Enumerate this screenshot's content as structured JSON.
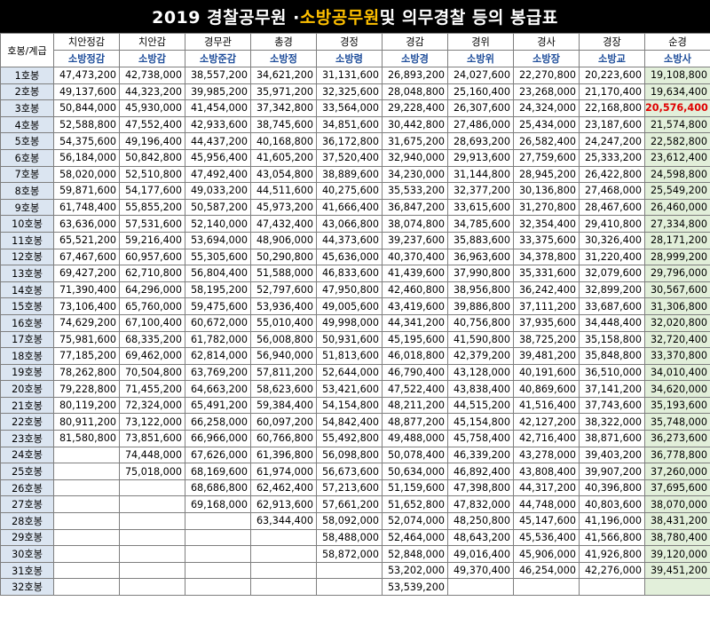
{
  "title": {
    "part1": "2019 경찰공무원 · ",
    "highlight": "소방공무원",
    "part2": " 및 의무경찰 등의 봉급표"
  },
  "header": {
    "rank_label": "호봉/계급",
    "ranks": [
      {
        "police": "치안정감",
        "fire": "소방정감"
      },
      {
        "police": "치안감",
        "fire": "소방감"
      },
      {
        "police": "경무관",
        "fire": "소방준감"
      },
      {
        "police": "총경",
        "fire": "소방정"
      },
      {
        "police": "경정",
        "fire": "소방령"
      },
      {
        "police": "경감",
        "fire": "소방경"
      },
      {
        "police": "경위",
        "fire": "소방위"
      },
      {
        "police": "경사",
        "fire": "소방장"
      },
      {
        "police": "경장",
        "fire": "소방교"
      },
      {
        "police": "순경",
        "fire": "소방사"
      }
    ]
  },
  "highlight_color": "#e00000",
  "highlight_cell": {
    "row": 3,
    "col": 9
  },
  "rows": [
    {
      "step": "1호봉",
      "v": [
        "47,473,200",
        "42,738,000",
        "38,557,200",
        "34,621,200",
        "31,131,600",
        "26,893,200",
        "24,027,600",
        "22,270,800",
        "20,223,600",
        "19,108,800"
      ]
    },
    {
      "step": "2호봉",
      "v": [
        "49,137,600",
        "44,323,200",
        "39,985,200",
        "35,971,200",
        "32,325,600",
        "28,048,800",
        "25,160,400",
        "23,268,000",
        "21,170,400",
        "19,634,400"
      ]
    },
    {
      "step": "3호봉",
      "v": [
        "50,844,000",
        "45,930,000",
        "41,454,000",
        "37,342,800",
        "33,564,000",
        "29,228,400",
        "26,307,600",
        "24,324,000",
        "22,168,800",
        "20,576,400"
      ]
    },
    {
      "step": "4호봉",
      "v": [
        "52,588,800",
        "47,552,400",
        "42,933,600",
        "38,745,600",
        "34,851,600",
        "30,442,800",
        "27,486,000",
        "25,434,000",
        "23,187,600",
        "21,574,800"
      ]
    },
    {
      "step": "5호봉",
      "v": [
        "54,375,600",
        "49,196,400",
        "44,437,200",
        "40,168,800",
        "36,172,800",
        "31,675,200",
        "28,693,200",
        "26,582,400",
        "24,247,200",
        "22,582,800"
      ]
    },
    {
      "step": "6호봉",
      "v": [
        "56,184,000",
        "50,842,800",
        "45,956,400",
        "41,605,200",
        "37,520,400",
        "32,940,000",
        "29,913,600",
        "27,759,600",
        "25,333,200",
        "23,612,400"
      ]
    },
    {
      "step": "7호봉",
      "v": [
        "58,020,000",
        "52,510,800",
        "47,492,400",
        "43,054,800",
        "38,889,600",
        "34,230,000",
        "31,144,800",
        "28,945,200",
        "26,422,800",
        "24,598,800"
      ]
    },
    {
      "step": "8호봉",
      "v": [
        "59,871,600",
        "54,177,600",
        "49,033,200",
        "44,511,600",
        "40,275,600",
        "35,533,200",
        "32,377,200",
        "30,136,800",
        "27,468,000",
        "25,549,200"
      ]
    },
    {
      "step": "9호봉",
      "v": [
        "61,748,400",
        "55,855,200",
        "50,587,200",
        "45,973,200",
        "41,666,400",
        "36,847,200",
        "33,615,600",
        "31,270,800",
        "28,467,600",
        "26,460,000"
      ]
    },
    {
      "step": "10호봉",
      "v": [
        "63,636,000",
        "57,531,600",
        "52,140,000",
        "47,432,400",
        "43,066,800",
        "38,074,800",
        "34,785,600",
        "32,354,400",
        "29,410,800",
        "27,334,800"
      ]
    },
    {
      "step": "11호봉",
      "v": [
        "65,521,200",
        "59,216,400",
        "53,694,000",
        "48,906,000",
        "44,373,600",
        "39,237,600",
        "35,883,600",
        "33,375,600",
        "30,326,400",
        "28,171,200"
      ]
    },
    {
      "step": "12호봉",
      "v": [
        "67,467,600",
        "60,957,600",
        "55,305,600",
        "50,290,800",
        "45,636,000",
        "40,370,400",
        "36,963,600",
        "34,378,800",
        "31,220,400",
        "28,999,200"
      ]
    },
    {
      "step": "13호봉",
      "v": [
        "69,427,200",
        "62,710,800",
        "56,804,400",
        "51,588,000",
        "46,833,600",
        "41,439,600",
        "37,990,800",
        "35,331,600",
        "32,079,600",
        "29,796,000"
      ]
    },
    {
      "step": "14호봉",
      "v": [
        "71,390,400",
        "64,296,000",
        "58,195,200",
        "52,797,600",
        "47,950,800",
        "42,460,800",
        "38,956,800",
        "36,242,400",
        "32,899,200",
        "30,567,600"
      ]
    },
    {
      "step": "15호봉",
      "v": [
        "73,106,400",
        "65,760,000",
        "59,475,600",
        "53,936,400",
        "49,005,600",
        "43,419,600",
        "39,886,800",
        "37,111,200",
        "33,687,600",
        "31,306,800"
      ]
    },
    {
      "step": "16호봉",
      "v": [
        "74,629,200",
        "67,100,400",
        "60,672,000",
        "55,010,400",
        "49,998,000",
        "44,341,200",
        "40,756,800",
        "37,935,600",
        "34,448,400",
        "32,020,800"
      ]
    },
    {
      "step": "17호봉",
      "v": [
        "75,981,600",
        "68,335,200",
        "61,782,000",
        "56,008,800",
        "50,931,600",
        "45,195,600",
        "41,590,800",
        "38,725,200",
        "35,158,800",
        "32,720,400"
      ]
    },
    {
      "step": "18호봉",
      "v": [
        "77,185,200",
        "69,462,000",
        "62,814,000",
        "56,940,000",
        "51,813,600",
        "46,018,800",
        "42,379,200",
        "39,481,200",
        "35,848,800",
        "33,370,800"
      ]
    },
    {
      "step": "19호봉",
      "v": [
        "78,262,800",
        "70,504,800",
        "63,769,200",
        "57,811,200",
        "52,644,000",
        "46,790,400",
        "43,128,000",
        "40,191,600",
        "36,510,000",
        "34,010,400"
      ]
    },
    {
      "step": "20호봉",
      "v": [
        "79,228,800",
        "71,455,200",
        "64,663,200",
        "58,623,600",
        "53,421,600",
        "47,522,400",
        "43,838,400",
        "40,869,600",
        "37,141,200",
        "34,620,000"
      ]
    },
    {
      "step": "21호봉",
      "v": [
        "80,119,200",
        "72,324,000",
        "65,491,200",
        "59,384,400",
        "54,154,800",
        "48,211,200",
        "44,515,200",
        "41,516,400",
        "37,743,600",
        "35,193,600"
      ]
    },
    {
      "step": "22호봉",
      "v": [
        "80,911,200",
        "73,122,000",
        "66,258,000",
        "60,097,200",
        "54,842,400",
        "48,877,200",
        "45,154,800",
        "42,127,200",
        "38,322,000",
        "35,748,000"
      ]
    },
    {
      "step": "23호봉",
      "v": [
        "81,580,800",
        "73,851,600",
        "66,966,000",
        "60,766,800",
        "55,492,800",
        "49,488,000",
        "45,758,400",
        "42,716,400",
        "38,871,600",
        "36,273,600"
      ]
    },
    {
      "step": "24호봉",
      "v": [
        "",
        "74,448,000",
        "67,626,000",
        "61,396,800",
        "56,098,800",
        "50,078,400",
        "46,339,200",
        "43,278,000",
        "39,403,200",
        "36,778,800"
      ]
    },
    {
      "step": "25호봉",
      "v": [
        "",
        "75,018,000",
        "68,169,600",
        "61,974,000",
        "56,673,600",
        "50,634,000",
        "46,892,400",
        "43,808,400",
        "39,907,200",
        "37,260,000"
      ]
    },
    {
      "step": "26호봉",
      "v": [
        "",
        "",
        "68,686,800",
        "62,462,400",
        "57,213,600",
        "51,159,600",
        "47,398,800",
        "44,317,200",
        "40,396,800",
        "37,695,600"
      ]
    },
    {
      "step": "27호봉",
      "v": [
        "",
        "",
        "69,168,000",
        "62,913,600",
        "57,661,200",
        "51,652,800",
        "47,832,000",
        "44,748,000",
        "40,803,600",
        "38,070,000"
      ]
    },
    {
      "step": "28호봉",
      "v": [
        "",
        "",
        "",
        "63,344,400",
        "58,092,000",
        "52,074,000",
        "48,250,800",
        "45,147,600",
        "41,196,000",
        "38,431,200"
      ]
    },
    {
      "step": "29호봉",
      "v": [
        "",
        "",
        "",
        "",
        "58,488,000",
        "52,464,000",
        "48,643,200",
        "45,536,400",
        "41,566,800",
        "38,780,400"
      ]
    },
    {
      "step": "30호봉",
      "v": [
        "",
        "",
        "",
        "",
        "58,872,000",
        "52,848,000",
        "49,016,400",
        "45,906,000",
        "41,926,800",
        "39,120,000"
      ]
    },
    {
      "step": "31호봉",
      "v": [
        "",
        "",
        "",
        "",
        "",
        "53,202,000",
        "49,370,400",
        "46,254,000",
        "42,276,000",
        "39,451,200"
      ]
    },
    {
      "step": "32호봉",
      "v": [
        "",
        "",
        "",
        "",
        "",
        "53,539,200",
        "",
        "",
        "",
        ""
      ]
    }
  ]
}
